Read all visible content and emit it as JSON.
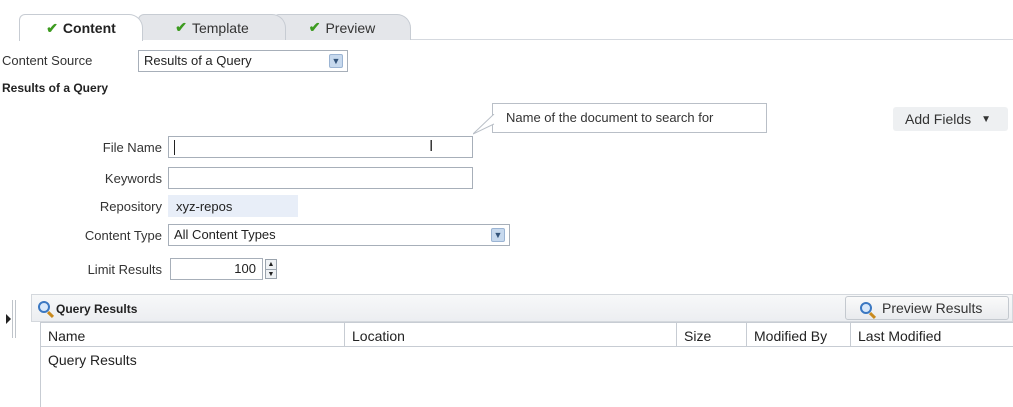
{
  "tabs": [
    {
      "label": "Content",
      "active": true
    },
    {
      "label": "Template",
      "active": false
    },
    {
      "label": "Preview",
      "active": false
    }
  ],
  "content_source": {
    "label": "Content Source",
    "value": "Results of a Query"
  },
  "section_title": "Results of a Query",
  "tooltip": "Name of the document to search for",
  "add_fields_label": "Add Fields",
  "form": {
    "file_name": {
      "label": "File Name",
      "value": ""
    },
    "keywords": {
      "label": "Keywords",
      "value": ""
    },
    "repository": {
      "label": "Repository",
      "value": "xyz-repos"
    },
    "content_type": {
      "label": "Content Type",
      "value": "All Content Types"
    },
    "limit_results": {
      "label": "Limit Results",
      "value": "100"
    }
  },
  "query_results": {
    "title": "Query Results",
    "preview_button": "Preview Results",
    "columns": [
      "Name",
      "Location",
      "Size",
      "Modified By",
      "Last Modified"
    ],
    "first_row": "Query Results"
  },
  "colors": {
    "accent": "#3d9b20",
    "panel_border": "#c7ccd3",
    "selection": "#e8eef8"
  }
}
